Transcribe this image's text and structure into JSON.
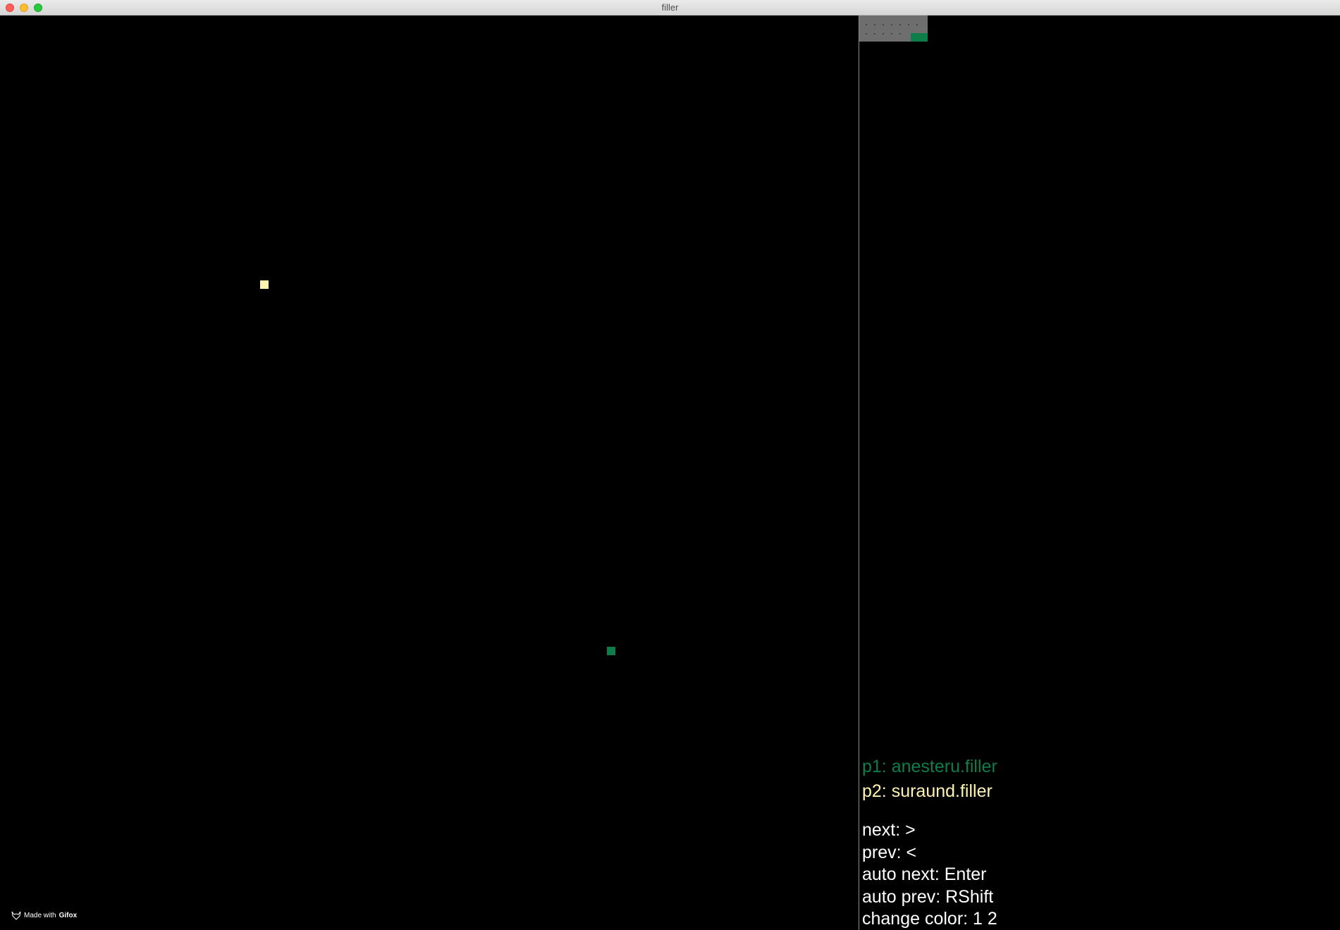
{
  "window": {
    "title": "filler"
  },
  "board": {
    "player1_color": "#0e7d49",
    "player2_color": "#fff3b0"
  },
  "piece_preview": {
    "background": "#6e6e6e"
  },
  "players": {
    "p1": "p1: anesteru.filler",
    "p2": "p2: suraund.filler"
  },
  "controls": {
    "next": "next: >",
    "prev": "prev: <",
    "auto_next": "auto next: Enter",
    "auto_prev": "auto prev: RShift",
    "change_color": "change color: 1 2"
  },
  "watermark": {
    "prefix": "Made with",
    "brand": "Gifox"
  }
}
